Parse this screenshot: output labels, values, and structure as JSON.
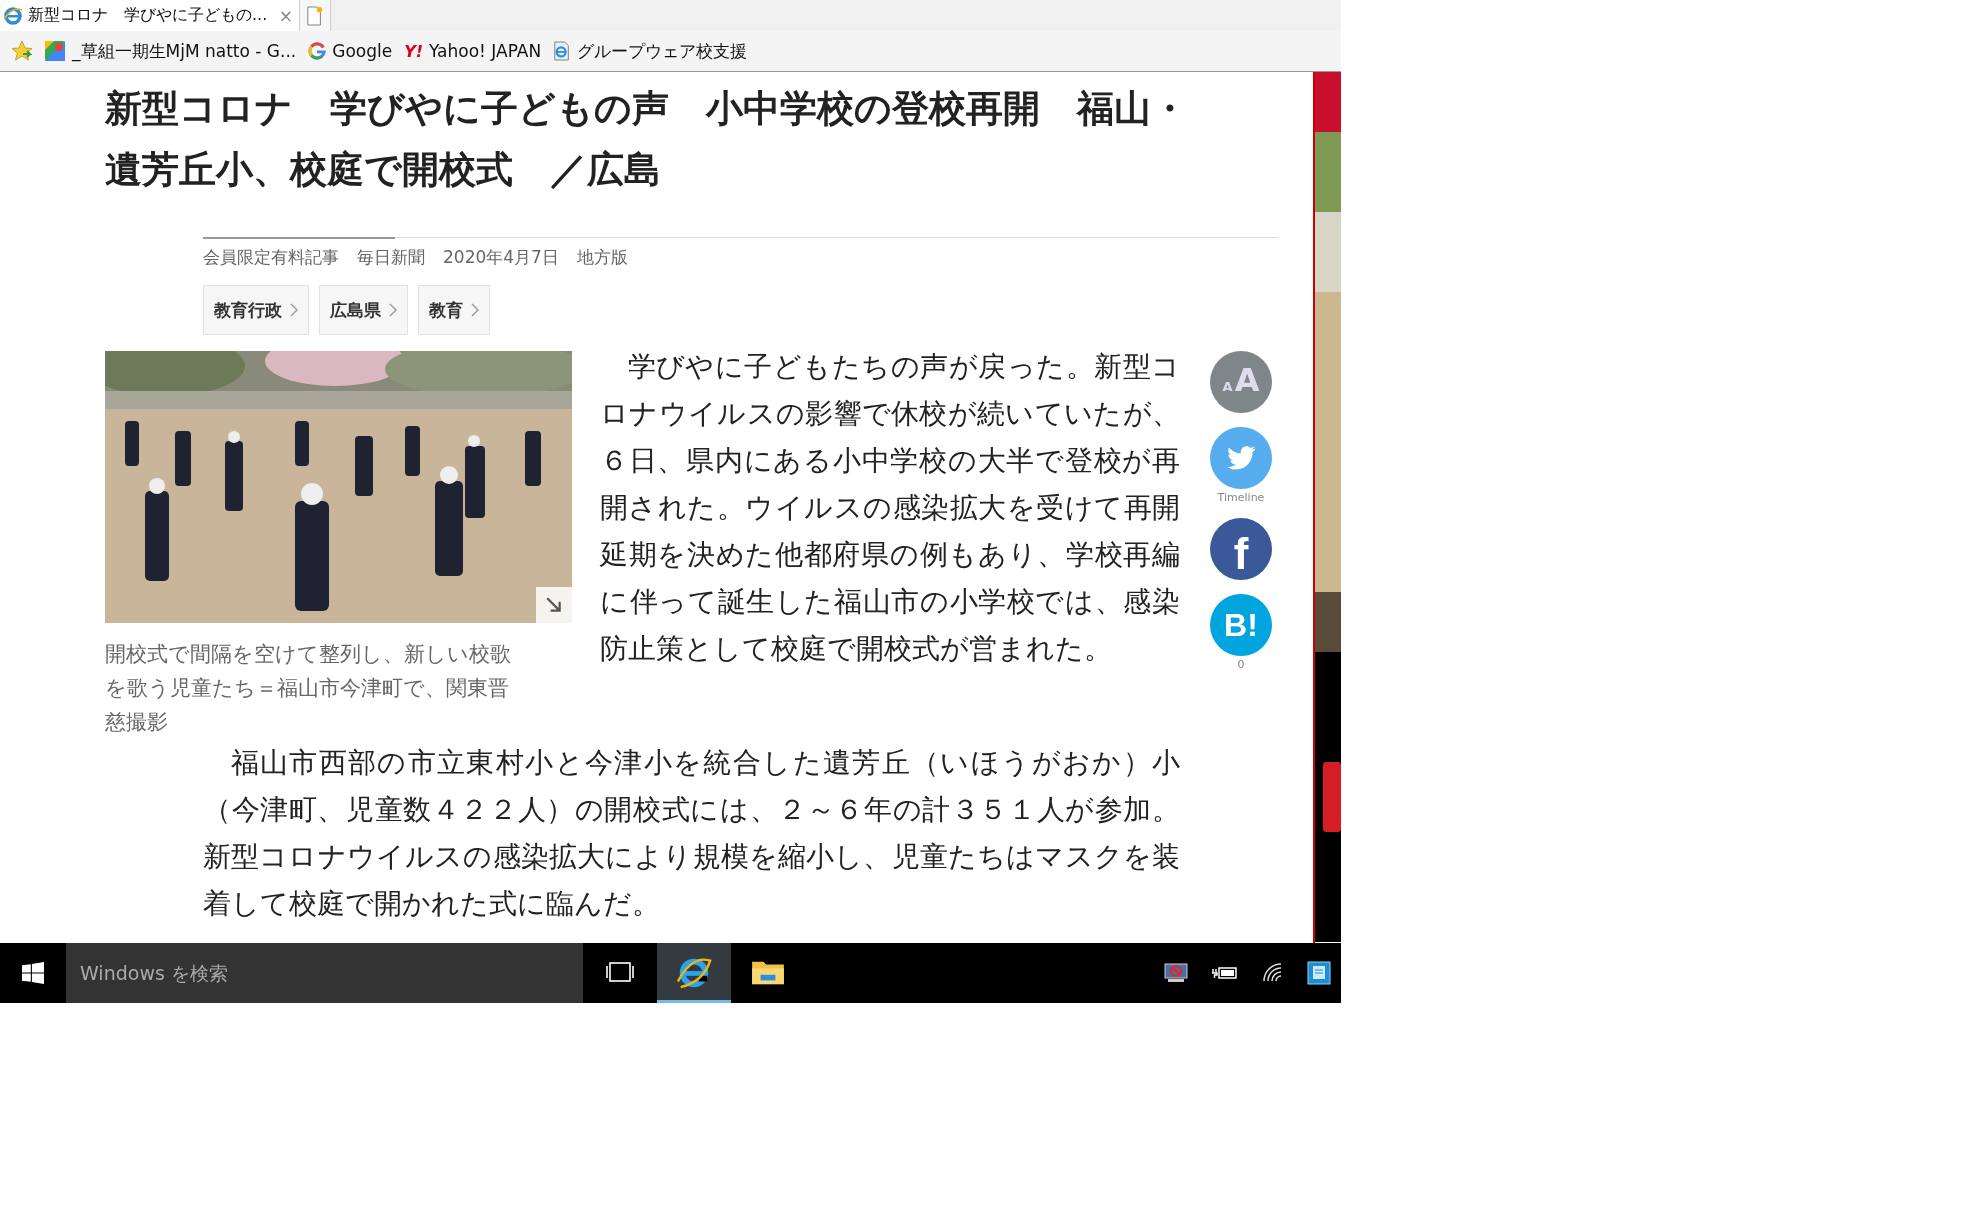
{
  "browser": {
    "tab": {
      "title": "新型コロナ　学びやに子どもの...",
      "close": "×"
    },
    "favorites": [
      {
        "kind": "maps",
        "label": "_草組一期生MjM natto - G..."
      },
      {
        "kind": "google",
        "label": "Google"
      },
      {
        "kind": "yahoo",
        "mark": "Y!",
        "label": "Yahoo! JAPAN"
      },
      {
        "kind": "ie",
        "label": "グループウェア校支援"
      }
    ]
  },
  "article": {
    "title": "新型コロナ　学びやに子どもの声　小中学校の登校再開　福山・遺芳丘小、校庭で開校式　／広島",
    "meta": [
      "会員限定有料記事",
      "毎日新聞",
      "2020年4月7日",
      "地方版"
    ],
    "tags": [
      "教育行政",
      "広島県",
      "教育"
    ],
    "photo": {
      "caption": "開校式で間隔を空けて整列し、新しい校歌を歌う児童たち＝福山市今津町で、関東晋慈撮影"
    },
    "paragraphs": [
      "学びやに子どもたちの声が戻った。新型コロナウイルスの影響で休校が続いていたが、６日、県内にある小中学校の大半で登校が再開された。ウイルスの感染拡大を受けて再開延期を決めた他都府県の例もあり、学校再編に伴って誕生した福山市の小学校では、感染防止策として校庭で開校式が営まれた。",
      "福山市西部の市立東村小と今津小を統合した遺芳丘（いほうがおか）小（今津町、児童数４２２人）の開校式には、２～６年の計３５１人が参加。新型コロナウイルスの感染拡大により規模を縮小し、児童たちはマスクを装着して校庭で開かれた式に臨んだ。"
    ],
    "social": [
      {
        "kind": "fontsize",
        "small": "A",
        "big": "A"
      },
      {
        "kind": "twitter",
        "label": "Timeline"
      },
      {
        "kind": "facebook",
        "mark": "f"
      },
      {
        "kind": "hatena",
        "mark": "B!",
        "label": "0"
      }
    ]
  },
  "taskbar": {
    "search": {
      "placeholder": "Windows を検索"
    },
    "apps": [
      {
        "kind": "taskview",
        "selected": false
      },
      {
        "kind": "ie",
        "selected": true
      },
      {
        "kind": "folder",
        "selected": false
      }
    ]
  }
}
